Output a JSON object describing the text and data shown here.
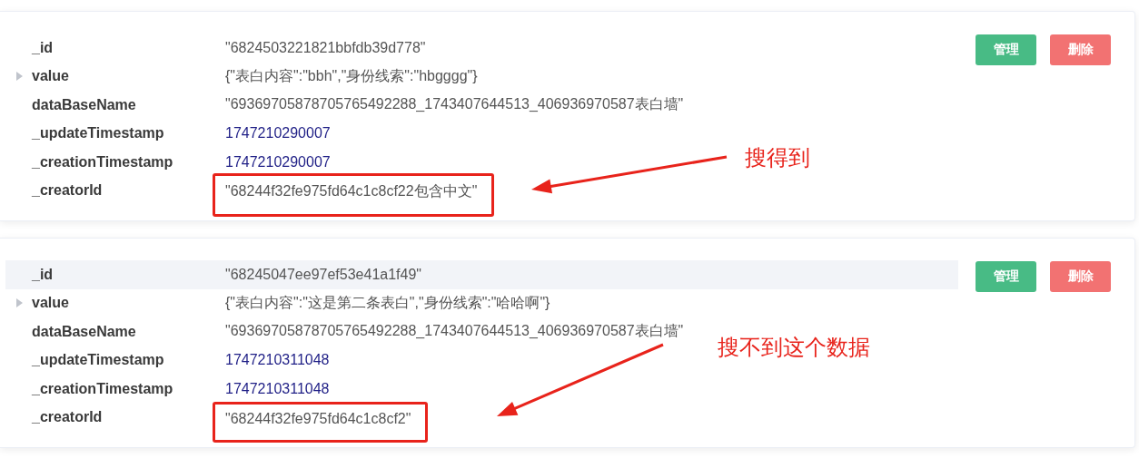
{
  "records": [
    {
      "fields": [
        {
          "key": "_id",
          "value": "\"6824503221821bbfdb39d778\"",
          "kind": "string",
          "highlighted": false,
          "boxed": false
        },
        {
          "key": "value",
          "value": "{\"表白内容\":\"bbh\",\"身份线索\":\"hbgggg\"}",
          "kind": "object",
          "highlighted": false,
          "boxed": false
        },
        {
          "key": "dataBaseName",
          "value": "\"69369705878705765492288_1743407644513_406936970587表白墙\"",
          "kind": "string",
          "highlighted": false,
          "boxed": false
        },
        {
          "key": "_updateTimestamp",
          "value": "1747210290007",
          "kind": "number",
          "highlighted": false,
          "boxed": false
        },
        {
          "key": "_creationTimestamp",
          "value": "1747210290007",
          "kind": "number",
          "highlighted": false,
          "boxed": false
        },
        {
          "key": "_creatorId",
          "value": "\"68244f32fe975fd64c1c8cf22包含中文\"",
          "kind": "string",
          "highlighted": false,
          "boxed": true
        }
      ],
      "buttons": [
        {
          "label": "管理",
          "kind": "manage"
        },
        {
          "label": "删除",
          "kind": "delete"
        }
      ],
      "annotation": "搜得到"
    },
    {
      "fields": [
        {
          "key": "_id",
          "value": "\"68245047ee97ef53e41a1f49\"",
          "kind": "string",
          "highlighted": true,
          "boxed": false
        },
        {
          "key": "value",
          "value": "{\"表白内容\":\"这是第二条表白\",\"身份线索\":\"哈哈啊\"}",
          "kind": "object",
          "highlighted": false,
          "boxed": false
        },
        {
          "key": "dataBaseName",
          "value": "\"69369705878705765492288_1743407644513_406936970587表白墙\"",
          "kind": "string",
          "highlighted": false,
          "boxed": false
        },
        {
          "key": "_updateTimestamp",
          "value": "1747210311048",
          "kind": "number",
          "highlighted": false,
          "boxed": false
        },
        {
          "key": "_creationTimestamp",
          "value": "1747210311048",
          "kind": "number",
          "highlighted": false,
          "boxed": false
        },
        {
          "key": "_creatorId",
          "value": "\"68244f32fe975fd64c1c8cf2\"",
          "kind": "string",
          "highlighted": false,
          "boxed": true
        }
      ],
      "buttons": [
        {
          "label": "管理",
          "kind": "manage"
        },
        {
          "label": "删除",
          "kind": "delete"
        }
      ],
      "annotation": "搜不到这个数据"
    }
  ]
}
